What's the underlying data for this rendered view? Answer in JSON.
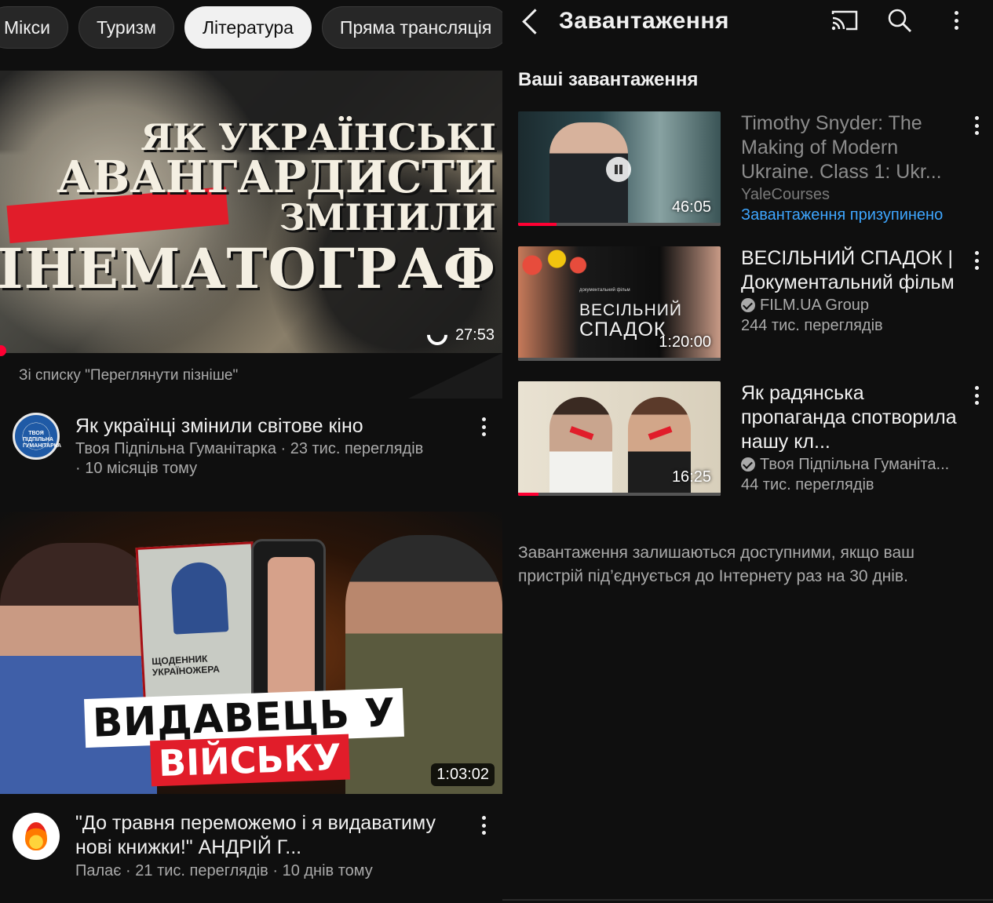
{
  "left": {
    "chips": [
      "Мікси",
      "Туризм",
      "Література",
      "Пряма трансляція"
    ],
    "active_chip": "Література",
    "video1": {
      "thumb_lines": [
        "ЯК УКРАЇНСЬКІ",
        "АВАНГАРДИСТИ",
        "ЗМІНИЛИ",
        "КІНЕМАТОГРАФ"
      ],
      "duration": "27:53",
      "from_list": "Зі списку \"Переглянути пізніше\"",
      "title": "Як українці змінили світове кіно",
      "channel_views": "Твоя Підпільна Гуманітарка · 23 тис. переглядів",
      "age": "· 10 місяців тому",
      "avatar_text": "ТВОЯ ПІДПІЛЬНА ГУМАНІТАРКА"
    },
    "video2": {
      "banner_top": "ВИДАВЕЦЬ У",
      "banner_bottom": "ВІЙСЬКУ",
      "book_title": "ЩОДЕННИК УКРАЇНОЖЕРА",
      "duration": "1:03:02",
      "title": "\"До травня переможемо і я видаватиму нові книжки!\" АНДРІЙ Г...",
      "meta": "Палає · 21 тис. переглядів · 10 днів тому"
    }
  },
  "right": {
    "page_title": "Завантаження",
    "section_title": "Ваші завантаження",
    "downloads": [
      {
        "title": "Timothy Snyder: The Making of Modern Ukraine. Class 1: Ukr...",
        "channel": "YaleCourses",
        "status": "Завантаження призупинено",
        "duration": "46:05",
        "progress": 0.19
      },
      {
        "title": "ВЕСІЛЬНИЙ СПАДОК | Документальний фільм",
        "channel": "FILM.UA Group",
        "views": "244 тис. переглядів",
        "duration": "1:20:00",
        "thumb_small": "документальний фільм",
        "thumb_big1": "ВЕСІЛЬНИЙ",
        "thumb_big2": "СПАДОК",
        "progress": 0
      },
      {
        "title": "Як радянська пропаганда спотворила нашу кл...",
        "channel": "Твоя Підпільна Гуманіта...",
        "views": "44 тис. переглядів",
        "duration": "16:25",
        "progress": 0.1
      }
    ],
    "note": "Завантаження залишаються доступними, якщо ваш пристрій під’єднується до Інтернету раз на 30 днів."
  },
  "colors": {
    "background": "#0f0f0f",
    "accent_red": "#ff0033",
    "link_blue": "#3ea6ff",
    "secondary_text": "#aaaaaa"
  },
  "icons": [
    "back-arrow-icon",
    "cast-icon",
    "search-icon",
    "more-vert-icon",
    "pause-icon",
    "verified-icon",
    "loading-icon",
    "flame-icon"
  ]
}
